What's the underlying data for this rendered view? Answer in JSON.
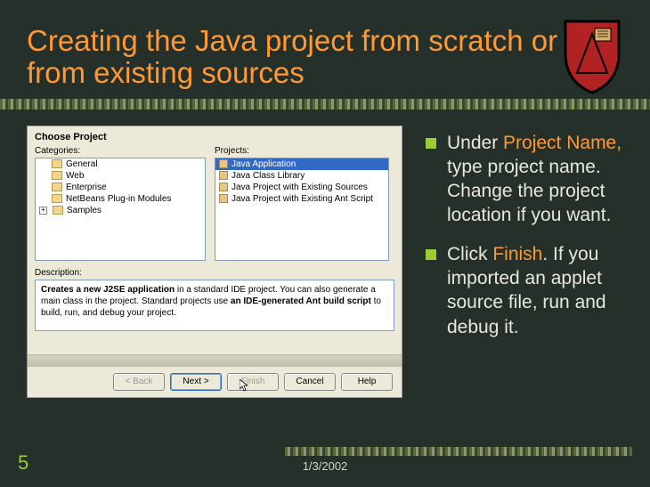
{
  "title": "Creating the Java project from scratch or from existing sources",
  "dialog": {
    "header": "Choose Project",
    "categories_label": "Categories:",
    "projects_label": "Projects:",
    "categories": [
      "General",
      "Web",
      "Enterprise",
      "NetBeans Plug-in Modules",
      "Samples"
    ],
    "projects": [
      "Java Application",
      "Java Class Library",
      "Java Project with Existing Sources",
      "Java Project with Existing Ant Script"
    ],
    "selected_project_index": 0,
    "description_label": "Description:",
    "description_html": "Creates a new J2SE application in a standard IDE project. You can also generate a main class in the project. Standard projects use an IDE-generated Ant build script to build, run, and debug your project.",
    "buttons": {
      "back": "< Back",
      "next": "Next >",
      "finish": "Finish",
      "cancel": "Cancel",
      "help": "Help"
    }
  },
  "bullets": [
    {
      "pre": "Under ",
      "hl": "Project Name,",
      "post": " type project name. Change the project location if you want."
    },
    {
      "pre": "Click ",
      "hl": "Finish",
      "post": ".  If you imported an applet source file,  run and debug it."
    }
  ],
  "page_number": "5",
  "date": "1/3/2002"
}
